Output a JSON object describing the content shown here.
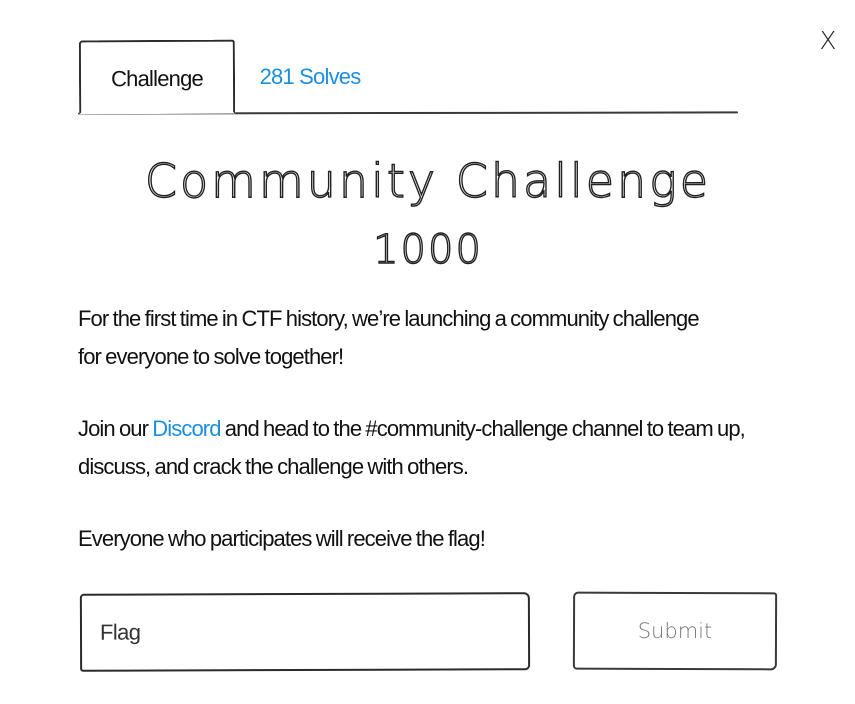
{
  "close": {
    "label": "X"
  },
  "tabs": [
    {
      "label": "Challenge",
      "active": true
    },
    {
      "label": "281 Solves",
      "active": false
    }
  ],
  "challenge": {
    "name": "Community Challenge",
    "value": "1000"
  },
  "description": {
    "paragraph1": "For the first time in CTF history, we’re launching a community challenge for everyone to solve together!",
    "paragraph2_before": "Join our ",
    "paragraph2_link": "Discord",
    "paragraph2_after": " and head to the #community-challenge channel to team up, discuss, and crack the challenge with others.",
    "paragraph3": "Everyone who participates will receive the flag!"
  },
  "form": {
    "flag_placeholder": "Flag",
    "flag_value": "",
    "submit_label": "Submit"
  },
  "colors": {
    "link": "#1a8fe0",
    "text": "#111111",
    "border": "#2b2b2b"
  }
}
